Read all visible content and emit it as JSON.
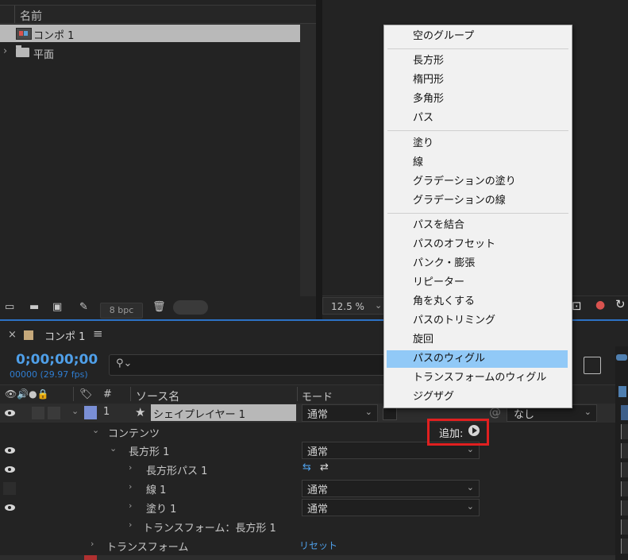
{
  "project": {
    "column_name": "名前",
    "items": [
      {
        "name": "コンポ 1",
        "icon": "composition-icon",
        "selected": true
      },
      {
        "name": "平面",
        "icon": "folder-icon",
        "selected": false
      }
    ],
    "bpc": "8 bpc"
  },
  "viewer": {
    "zoom": "12.5 %"
  },
  "timeline": {
    "tab_title": "コンポ 1",
    "timecode": "0;00;00;00",
    "fps": "00000 (29.97 fps)",
    "columns": {
      "number": "#",
      "source_name": "ソース名",
      "mode": "モード"
    },
    "layer": {
      "index": "1",
      "name": "シェイプレイヤー 1",
      "mode": "通常",
      "parent": "なし"
    },
    "rows": {
      "contents": "コンテンツ",
      "rectangle": "長方形 1",
      "rect_path": "長方形パス 1",
      "stroke": "線 1",
      "fill": "塗り 1",
      "rect_transform": "トランスフォーム：長方形 1",
      "transform": "トランスフォーム",
      "reset": "リセット"
    },
    "modes": {
      "rectangle": "通常",
      "stroke": "通常",
      "fill": "通常"
    },
    "add_label": "追加:"
  },
  "context_menu": {
    "groups": [
      [
        "空のグループ"
      ],
      [
        "長方形",
        "楕円形",
        "多角形",
        "パス"
      ],
      [
        "塗り",
        "線",
        "グラデーションの塗り",
        "グラデーションの線"
      ],
      [
        "パスを結合",
        "パスのオフセット",
        "パンク・膨張",
        "リピーター",
        "角を丸くする",
        "パスのトリミング",
        "旋回",
        "パスのウィグル",
        "トランスフォームのウィグル",
        "ジグザグ"
      ]
    ],
    "highlighted": "パスのウィグル"
  },
  "colors": {
    "accent_blue": "#2d72c5",
    "timecode_blue": "#4f9fe8",
    "highlight_red": "#e02020",
    "menu_highlight": "#91c9f7",
    "layer_label": "#7a8fd6"
  }
}
